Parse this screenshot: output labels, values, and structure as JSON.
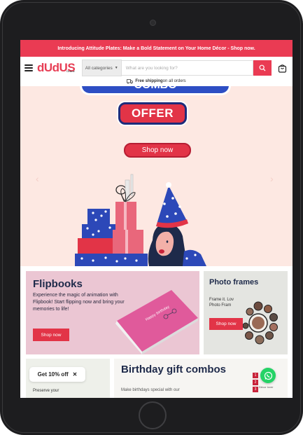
{
  "announcement": "Introducing Attitude Plates: Make a Bold Statement on Your Home Décor - Shop now.",
  "header": {
    "logo_main": "dUdUS",
    "logo_sub": "Online",
    "category_select": "All categories",
    "search_placeholder": "What are you looking for?"
  },
  "shipping": {
    "bold": "Free shipping",
    "rest": "on all orders"
  },
  "hero": {
    "heading_partial": "COMBO",
    "offer": "OFFER",
    "shop_now": "Shop now",
    "prev_arrow": "‹",
    "next_arrow": "›"
  },
  "tiles": {
    "flipbooks": {
      "title": "Flipbooks",
      "text": "Experience the magic of animation with Flipbook! Start flipping now and bring your memories to life!",
      "button": "Shop now",
      "book_label": "Happy birthday"
    },
    "photo_frames": {
      "title": "Photo frames",
      "text_line1": "Frame it. Lov",
      "text_line2": "Photo Fram",
      "button": "Shop now"
    },
    "birthday": {
      "title": "Birthday gift combos",
      "text": "Make birthdays special with our"
    },
    "preserve_text": "Preserve your",
    "clock_numbers": [
      "1",
      "2",
      "3"
    ],
    "decor_lover": "Décor lover"
  },
  "coupon": {
    "label": "Get 10% off",
    "close": "✕"
  },
  "colors": {
    "brand": "#ea3b53",
    "navy": "#1e2a4a",
    "whatsapp": "#25d366"
  },
  "icons": [
    "hamburger-icon",
    "search-icon",
    "cart-icon",
    "truck-icon",
    "chevron-left-icon",
    "chevron-right-icon",
    "close-icon",
    "whatsapp-icon"
  ]
}
